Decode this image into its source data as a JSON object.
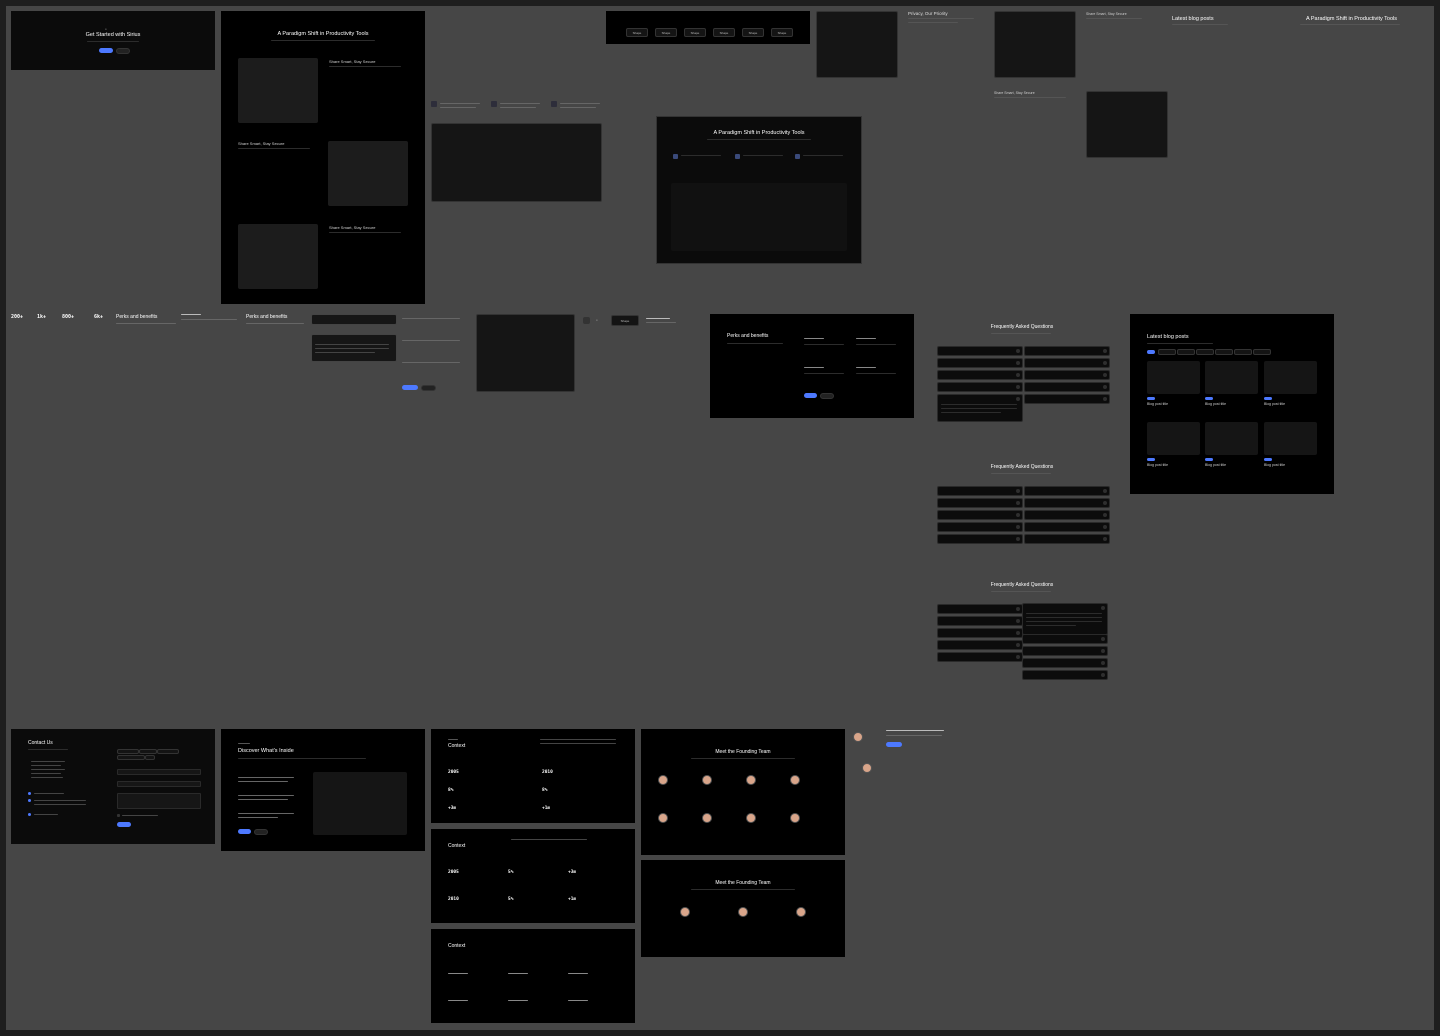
{
  "canvas": {
    "background": "#464646",
    "frame_color": "#000000",
    "accent": "#4d79ff"
  },
  "placeholder_logo": "",
  "cta": {
    "eyebrow": "●",
    "title": "Get Started with Sirius",
    "primary": "",
    "secondary": ""
  },
  "paradigm": {
    "title": "A Paradigm Shift in Productivity Tools",
    "features": [
      {
        "title": "Share Smart, Stay Secure"
      },
      {
        "title": "Share Smart, Stay Secure"
      },
      {
        "title": "Share Smart, Stay Secure"
      }
    ]
  },
  "logos": {
    "title": "",
    "items": [
      "Shape",
      "Shape",
      "Shape",
      "Shape",
      "Shape",
      "Shape"
    ]
  },
  "privacy": {
    "title": "Privacy, Our Priority"
  },
  "share_top": {
    "title": "Share Smart, Stay Secure"
  },
  "share_mid": {
    "title": "Share Smart, Stay Secure"
  },
  "blog_label": {
    "title": "Latest blog posts"
  },
  "paradigm_label": {
    "title": "A Paradigm Shift in Productivity Tools"
  },
  "paradigm2": {
    "title": "A Paradigm Shift in Productivity Tools"
  },
  "stats": [
    {
      "value": "200+"
    },
    {
      "value": "1k+"
    },
    {
      "value": "800+"
    },
    {
      "value": "6k+"
    }
  ],
  "perks_label": {
    "title": "Perks and benefits"
  },
  "perks_label2": {
    "title": "Perks and benefits"
  },
  "accordion": {
    "q1": "",
    "q2": ""
  },
  "shape_badge": {
    "label": "Shape"
  },
  "perks_frame": {
    "title": "Perks and benefits"
  },
  "faq": {
    "title": "Frequently Asked Questions"
  },
  "faq2": {
    "title": "Frequently Asked Questions"
  },
  "faq3": {
    "title": "Frequently Asked Questions"
  },
  "blog": {
    "title": "Latest blog posts",
    "posts": [
      {
        "title": "Blog post title"
      },
      {
        "title": "Blog post title"
      },
      {
        "title": "Blog post title"
      },
      {
        "title": "Blog post title"
      },
      {
        "title": "Blog post title"
      },
      {
        "title": "Blog post title"
      }
    ]
  },
  "contact": {
    "title": "Contact Us"
  },
  "discover": {
    "title": "Discover What's Inside"
  },
  "context1": {
    "title": "Context",
    "stats": [
      "2005",
      "8%",
      "+3m",
      "2010",
      "8%",
      "+1m"
    ]
  },
  "context2": {
    "title": "Context",
    "stats": [
      "2005",
      "5%",
      "+3m",
      "2010",
      "5%",
      "+1m"
    ]
  },
  "context3": {
    "title": "Context"
  },
  "team1": {
    "title": "Meet the Founding Team"
  },
  "team2": {
    "title": "Meet the Founding Team"
  }
}
